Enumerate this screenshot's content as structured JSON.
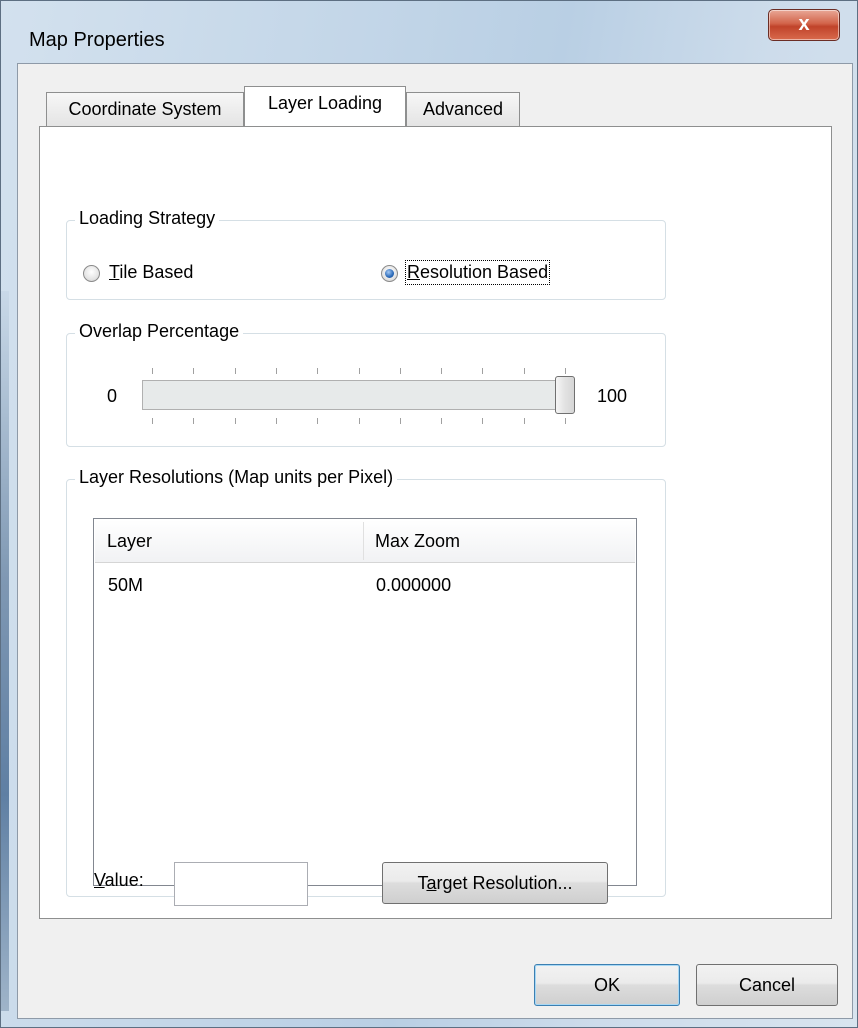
{
  "window": {
    "title": "Map Properties",
    "close_label": "x"
  },
  "tabs": [
    {
      "label": "Coordinate System",
      "active": false
    },
    {
      "label": "Layer Loading",
      "active": true
    },
    {
      "label": "Advanced",
      "active": false
    }
  ],
  "loading_strategy": {
    "title": "Loading Strategy",
    "options": [
      {
        "prefix": "",
        "mnemonic": "T",
        "rest": "ile Based",
        "checked": false
      },
      {
        "prefix": "",
        "mnemonic": "R",
        "rest": "esolution Based",
        "checked": true
      }
    ]
  },
  "overlap": {
    "title": "Overlap Percentage",
    "min_label": "0",
    "max_label": "100",
    "value_fraction": 1.0
  },
  "layer_resolutions": {
    "title": "Layer Resolutions (Map units per Pixel)",
    "columns": [
      "Layer",
      "Max Zoom"
    ],
    "rows": [
      {
        "layer": "50M",
        "max_zoom": "0.000000"
      }
    ],
    "value_label_mnemonic": "V",
    "value_label_rest": "alue:",
    "value_input": "",
    "target_button_prefix": "T",
    "target_button_mnemonic": "a",
    "target_button_rest": "rget Resolution..."
  },
  "buttons": {
    "ok": "OK",
    "cancel": "Cancel"
  }
}
